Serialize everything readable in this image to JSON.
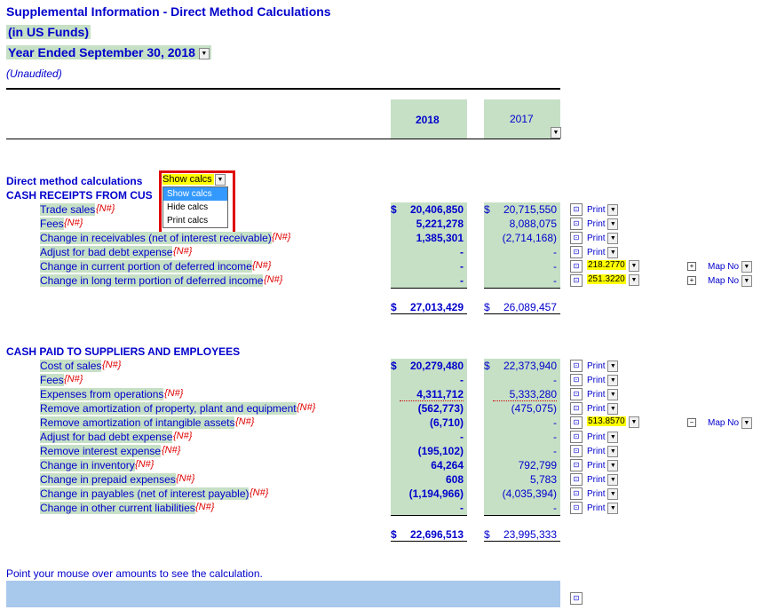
{
  "header": {
    "title": "Supplemental Information - Direct Method Calculations",
    "currency": "(in US Funds)",
    "year_ended": "Year Ended September 30, 2018",
    "unaudited": "(Unaudited)"
  },
  "columns": {
    "col1": "2018",
    "col2": "2017"
  },
  "calc_control": {
    "label": "Direct method calculations",
    "selected": "Show calcs",
    "options": [
      "Show calcs",
      "Hide calcs",
      "Print calcs"
    ]
  },
  "nh_tag": "{N#}",
  "receipts": {
    "heading": "CASH RECEIPTS FROM CUS",
    "rows": [
      {
        "label": "Trade sales",
        "v2018": "20,406,850",
        "v2017": "20,715,550",
        "cur": "$"
      },
      {
        "label": "Fees",
        "v2018": "5,221,278",
        "v2017": "8,088,075"
      },
      {
        "label": "Change in receivables (net of interest receivable)",
        "v2018": "1,385,301",
        "v2017": "(2,714,168)"
      },
      {
        "label": "Adjust for bad debt expense",
        "v2018": "-",
        "v2017": "-"
      },
      {
        "label": "Change in current portion of deferred income",
        "v2018": "-",
        "v2017": "-"
      },
      {
        "label": "Change in long term portion of deferred income",
        "v2018": "-",
        "v2017": "-"
      }
    ],
    "total2018": "27,013,429",
    "total2017": "26,089,457"
  },
  "paid": {
    "heading": "CASH PAID TO SUPPLIERS AND EMPLOYEES",
    "rows": [
      {
        "label": "Cost of sales",
        "v2018": "20,279,480",
        "v2017": "22,373,940"
      },
      {
        "label": "Fees",
        "v2018": "-",
        "v2017": "-"
      },
      {
        "label": "Expenses from operations",
        "v2018": "4,311,712",
        "v2017": "5,333,280"
      },
      {
        "label": "Remove amortization of property, plant and equipment",
        "v2018": "(562,773)",
        "v2017": "(475,075)"
      },
      {
        "label": "Remove amortization of intangible assets",
        "v2018": "(6,710)",
        "v2017": "-"
      },
      {
        "label": "Adjust for bad debt expense",
        "v2018": "-",
        "v2017": "-"
      },
      {
        "label": "Remove interest expense",
        "v2018": "(195,102)",
        "v2017": "-"
      },
      {
        "label": "Change in inventory",
        "v2018": "64,264",
        "v2017": "792,799"
      },
      {
        "label": "Change in prepaid expenses",
        "v2018": "608",
        "v2017": "5,783"
      },
      {
        "label": "Change in payables (net of interest payable)",
        "v2018": "(1,194,966)",
        "v2017": "(4,035,394)"
      },
      {
        "label": "Change in other current liabilities",
        "v2018": "-",
        "v2017": "-"
      }
    ],
    "total2018": "22,696,513",
    "total2017": "23,995,333"
  },
  "controls": {
    "print_label": "Print",
    "yellow1": "218.2770",
    "yellow2": "251.3220",
    "yellow3": "513.8570",
    "map_label": "Map No"
  },
  "currency_symbol": "$",
  "hint": "Point your mouse over amounts to see the calculation."
}
